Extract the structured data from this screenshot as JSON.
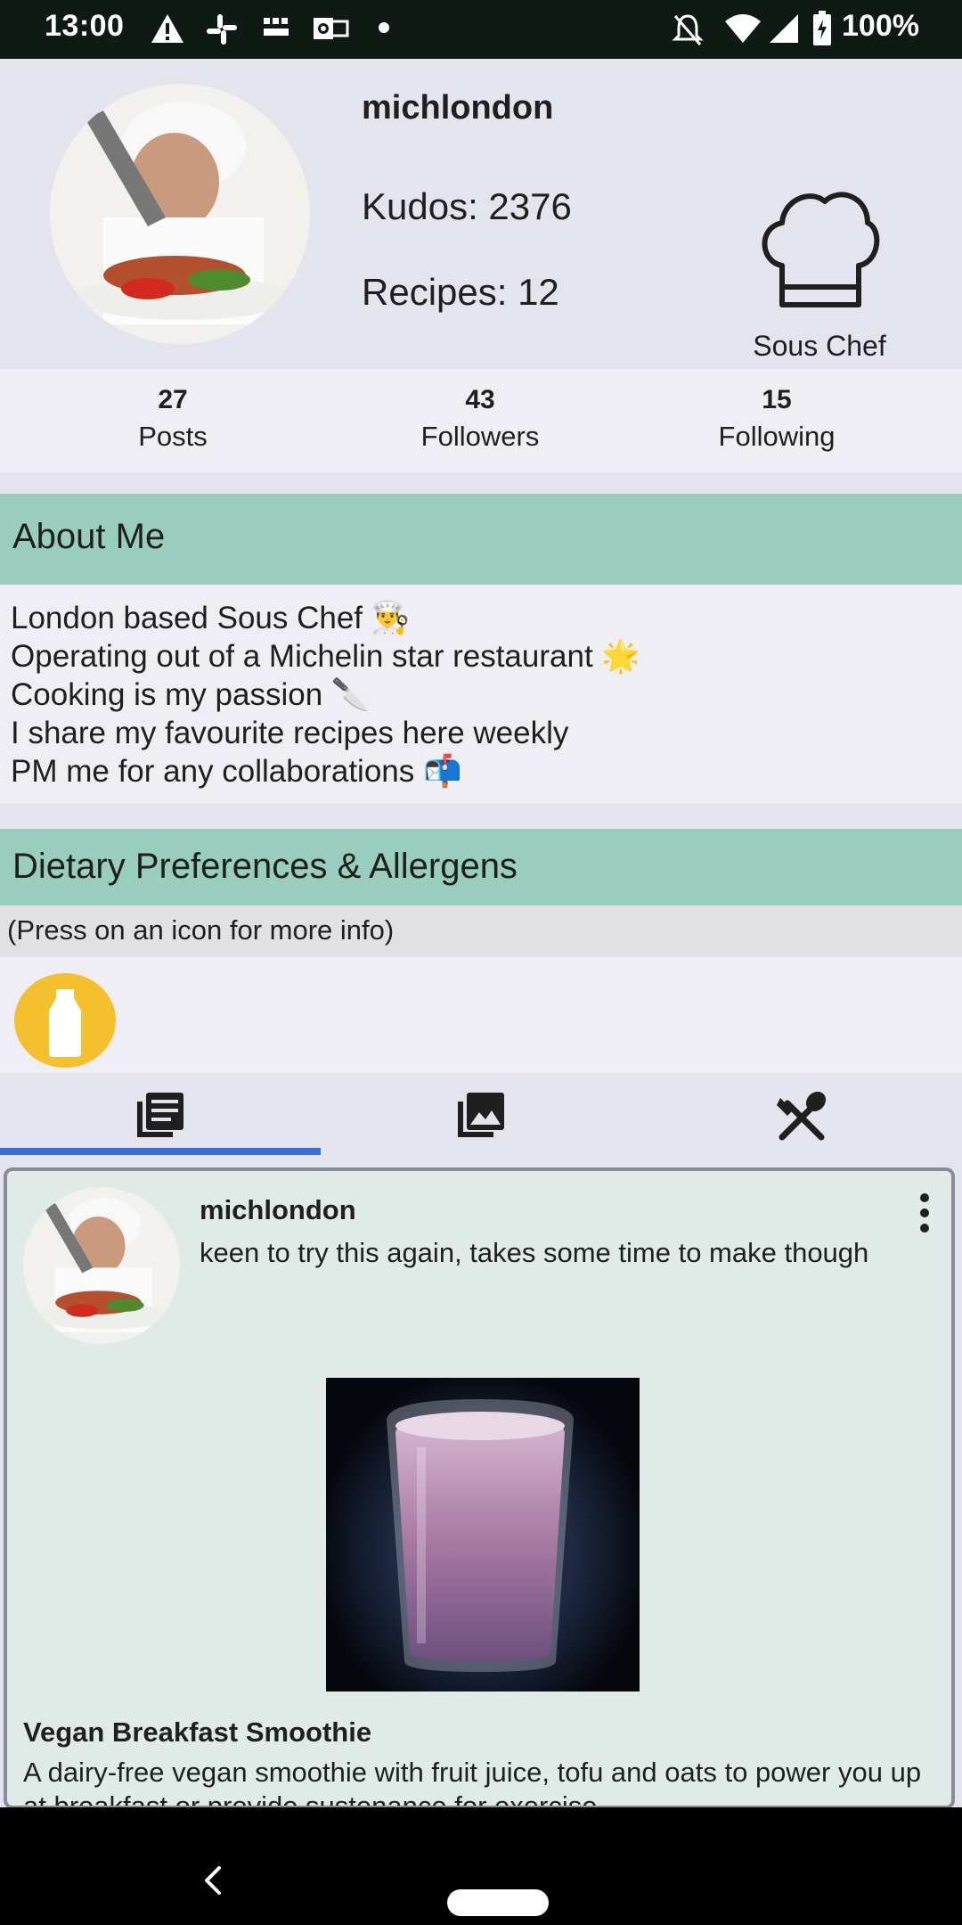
{
  "status_bar": {
    "time": "13:00",
    "battery": "100%",
    "icons": [
      "warning-icon",
      "slack-icon",
      "bbc-news-icon",
      "outlook-icon",
      "dot-icon",
      "mute-icon",
      "wifi-icon",
      "signal-icon",
      "battery-icon"
    ]
  },
  "profile": {
    "username": "michlondon",
    "kudos": "Kudos: 2376",
    "recipes": "Recipes: 12",
    "rank": "Sous Chef",
    "rank_icon": "chef-hat-icon"
  },
  "stats": [
    {
      "value": "27",
      "label": "Posts"
    },
    {
      "value": "43",
      "label": "Followers"
    },
    {
      "value": "15",
      "label": "Following"
    }
  ],
  "about": {
    "title": "About Me",
    "lines": [
      "London based Sous Chef 👨‍🍳",
      "Operating out of a Michelin star restaurant 🌟",
      "Cooking is my passion 🔪",
      "I share my favourite recipes here weekly",
      "PM me for any collaborations 📬"
    ]
  },
  "dietary": {
    "title": "Dietary Preferences & Allergens",
    "hint": "(Press on an icon for more info)",
    "icons": [
      "milk-bottle-icon"
    ],
    "accent": "#f5c02d"
  },
  "tabs": {
    "items": [
      "posts-tab",
      "gallery-tab",
      "recipes-tab"
    ],
    "active": 0,
    "indicator_color": "#3c6fd6"
  },
  "post": {
    "username": "michlondon",
    "text": "keen to try this again, takes some time to make though",
    "recipe_title": "Vegan Breakfast Smoothie",
    "recipe_desc": "A dairy-free vegan smoothie with fruit juice, tofu and oats to power you up at breakfast or provide sustenance for exercise"
  },
  "colors": {
    "section_header": "#99cdbd",
    "card_bg": "#e0ebe7",
    "page_bg": "#e4e4ef"
  }
}
